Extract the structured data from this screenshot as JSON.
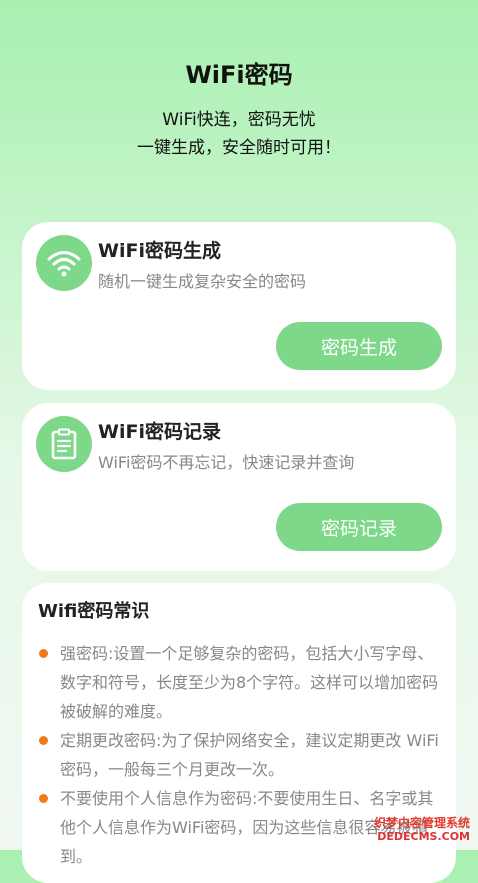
{
  "header": {
    "title": "WiFi密码",
    "subtitle_line1": "WiFi快连，密码无忧",
    "subtitle_line2": "一键生成，安全随时可用！"
  },
  "cards": {
    "generate": {
      "icon": "wifi-icon",
      "title": "WiFi密码生成",
      "desc": "随机一键生成复杂安全的密码",
      "button": "密码生成"
    },
    "record": {
      "icon": "clipboard-icon",
      "title": "WiFi密码记录",
      "desc": "WiFi密码不再忘记，快速记录并查询",
      "button": "密码记录"
    }
  },
  "tips": {
    "title": "Wifi密码常识",
    "items": [
      "强密码:设置一个足够复杂的密码，包括大小写字母、数字和符号，长度至少为8个字符。这样可以增加密码被破解的难度。",
      "定期更改密码:为了保护网络安全，建议定期更改 WiFi密码，一般每三个月更改一次。",
      "不要使用个人信息作为密码:不要使用生日、名字或其他个人信息作为WiFi密码，因为这些信息很容易被猜到。"
    ]
  },
  "watermark": {
    "line1": "织梦内容管理系统",
    "line2": "DEDECMS.COM"
  },
  "colors": {
    "accent_green": "#7ed88a",
    "bullet_orange": "#f07b1d"
  }
}
